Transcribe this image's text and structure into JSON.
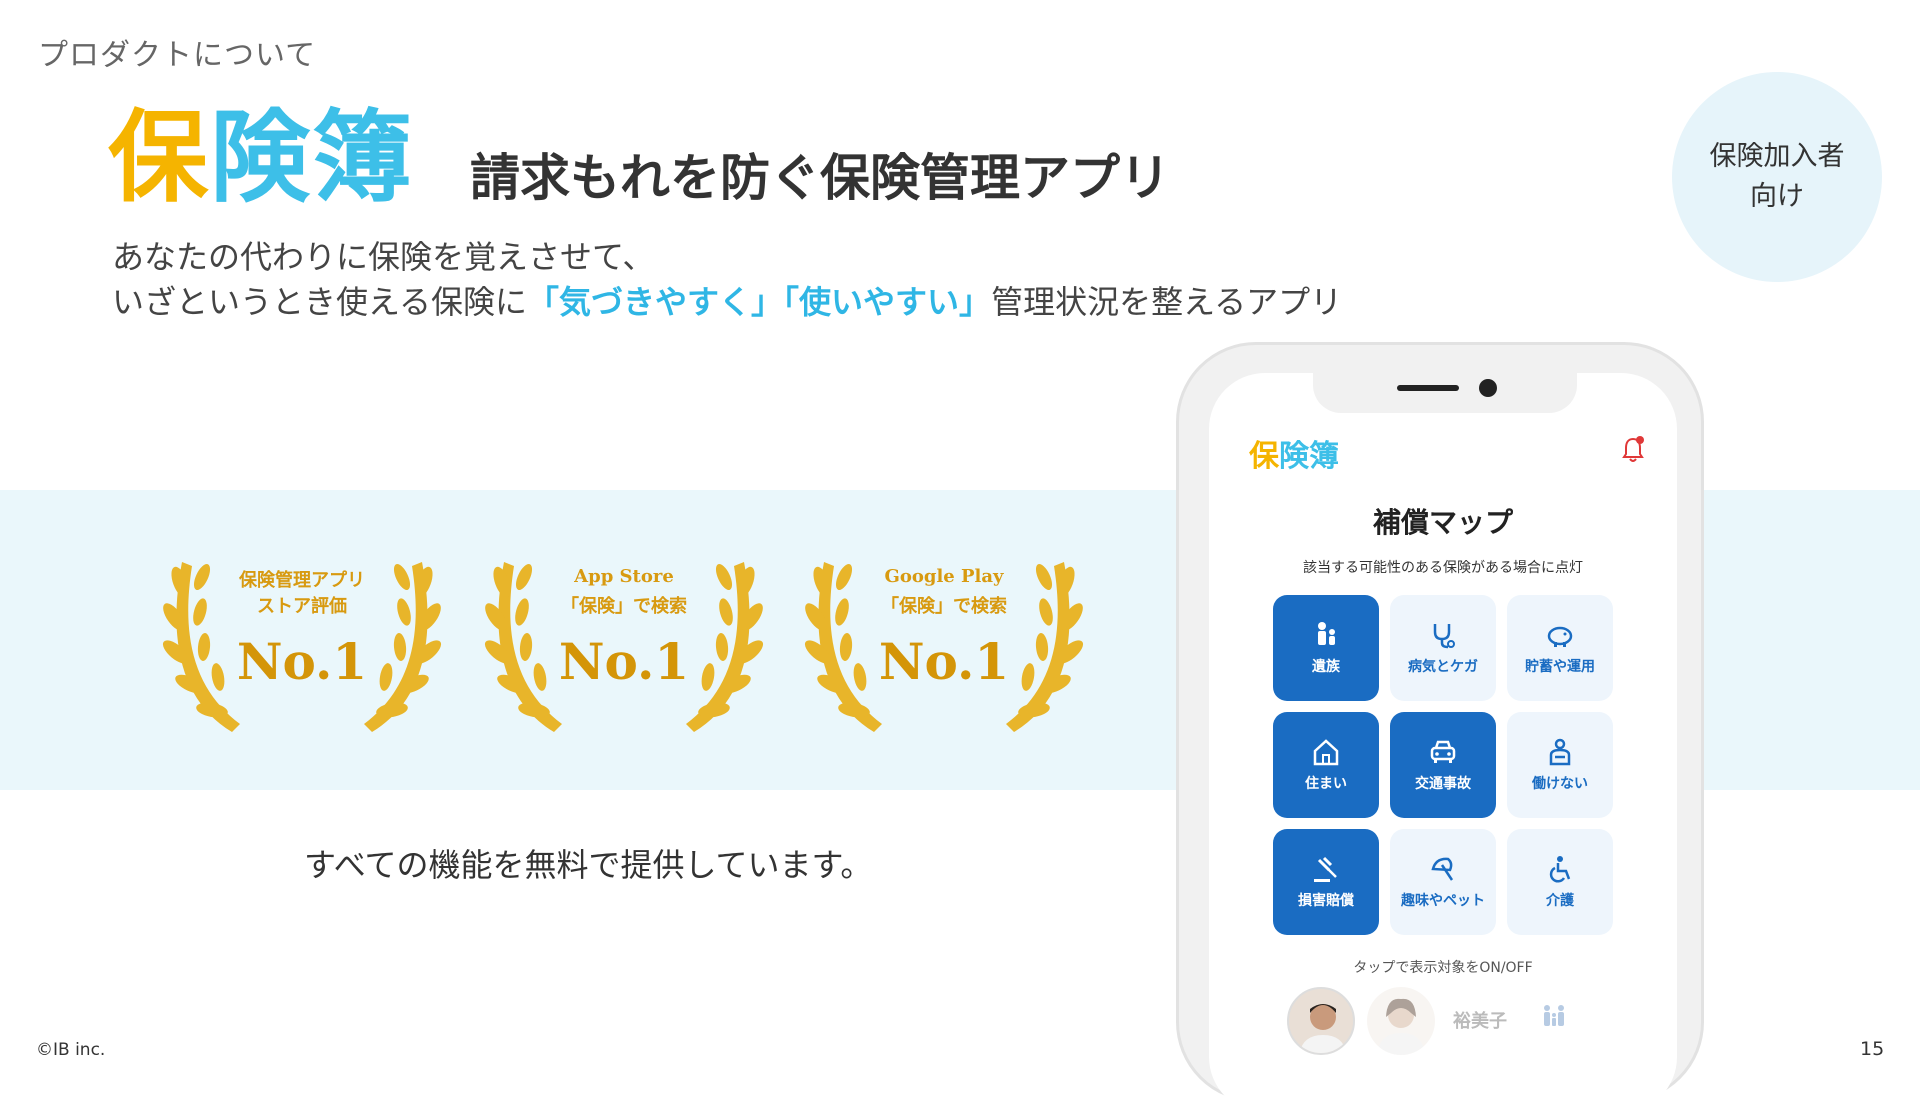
{
  "section_label": "プロダクトについて",
  "logo": {
    "part1": "保",
    "part2": "険簿"
  },
  "tagline": "請求もれを防ぐ保険管理アプリ",
  "target_badge": {
    "line1": "保険加入者",
    "line2": "向け"
  },
  "lead": {
    "line1": "あなたの代わりに保険を覚えさせて、",
    "line2_prefix": "いざというとき使える保険に",
    "line2_highlight": "「気づきやすく」「使いやすい」",
    "line2_suffix": "管理状況を整えるアプリ"
  },
  "awards": [
    {
      "line1": "保険管理アプリ",
      "line2": "ストア評価",
      "rank": "No.1"
    },
    {
      "line1": "App Store",
      "line2": "「保険」で検索",
      "rank": "No.1"
    },
    {
      "line1": "Google Play",
      "line2": "「保険」で検索",
      "rank": "No.1"
    }
  ],
  "free_text": "すべての機能を無料で提供しています。",
  "copyright": "©IB inc.",
  "page_number": "15",
  "phone": {
    "app_logo": {
      "part1": "保",
      "part2": "険簿"
    },
    "title": "補償マップ",
    "subtitle": "該当する可能性のある保険がある場合に点灯",
    "tiles": [
      {
        "label": "遺族",
        "icon": "family-person-icon",
        "active": true
      },
      {
        "label": "病気とケガ",
        "icon": "stethoscope-icon",
        "active": false
      },
      {
        "label": "貯蓄や運用",
        "icon": "piggy-bank-icon",
        "active": false
      },
      {
        "label": "住まい",
        "icon": "house-icon",
        "active": true
      },
      {
        "label": "交通事故",
        "icon": "car-icon",
        "active": true
      },
      {
        "label": "働けない",
        "icon": "injured-person-icon",
        "active": false
      },
      {
        "label": "損害賠償",
        "icon": "gavel-icon",
        "active": true
      },
      {
        "label": "趣味やペット",
        "icon": "umbrella-icon",
        "active": false
      },
      {
        "label": "介護",
        "icon": "wheelchair-icon",
        "active": false
      }
    ],
    "tap_note": "タップで表示対象をON/OFF",
    "member_name": "裕美子"
  },
  "colors": {
    "accent": "#3dbfe8",
    "logo_yellow": "#f5b400",
    "tile_on": "#1a6cc2",
    "band": "#eaf7fb",
    "gold": "#d89a10"
  }
}
